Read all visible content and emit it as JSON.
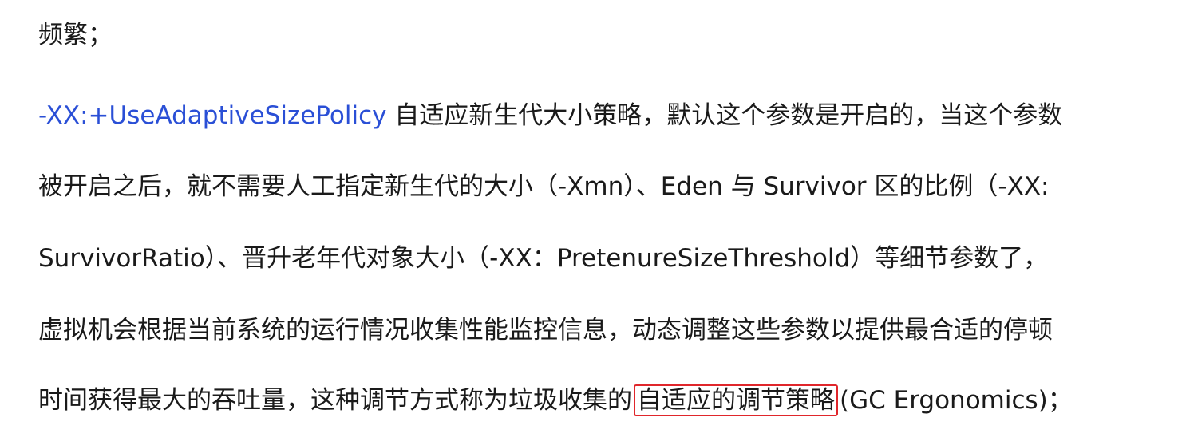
{
  "document": {
    "lines": [
      {
        "text": "频繁；"
      },
      {
        "param": "-XX:+UseAdaptiveSizePolicy",
        "text": " 自适应新生代大小策略，默认这个参数是开启的，当这个参数"
      },
      {
        "text": "被开启之后，就不需要人工指定新生代的大小（-Xmn）、Eden 与 Survivor 区的比例（-XX:"
      },
      {
        "text": "SurvivorRatio）、晋升老年代对象大小（-XX：PretenureSizeThreshold）等细节参数了，"
      },
      {
        "text": "虚拟机会根据当前系统的运行情况收集性能监控信息，动态调整这些参数以提供最合适的停顿"
      },
      {
        "before": "时间获得最大的吞吐量，这种调节方式称为垃圾收集的",
        "highlighted": "自适应的调节策略",
        "after": "(GC Ergonomics)；"
      }
    ]
  },
  "colors": {
    "param_text": "#2a4fd6",
    "body_text": "#1a1a1a",
    "highlight_border": "#e0262b",
    "background": "#ffffff"
  }
}
